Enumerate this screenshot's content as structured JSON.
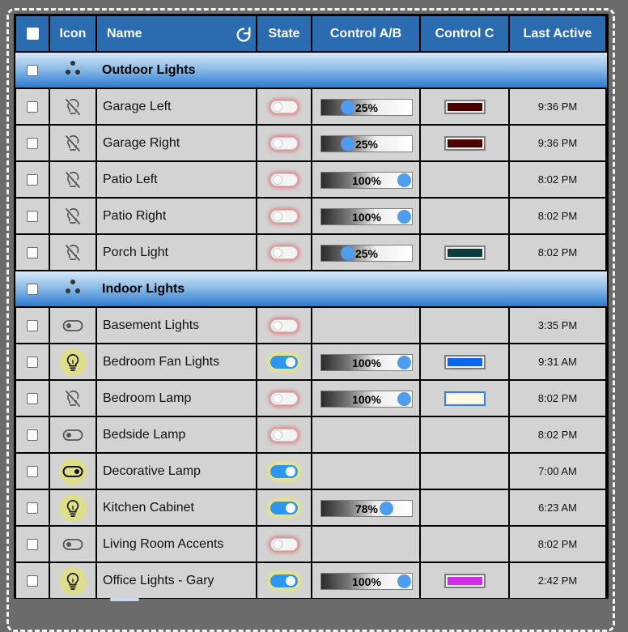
{
  "header": {
    "icon_label": "Icon",
    "name_label": "Name",
    "state_label": "State",
    "control_ab_label": "Control A/B",
    "control_c_label": "Control C",
    "last_active_label": "Last Active"
  },
  "groups": [
    {
      "title": "Outdoor Lights",
      "devices": [
        {
          "name": "Garage Left",
          "icon": "bulb-off-icon",
          "state": "off",
          "level": 25,
          "level_label": "25%",
          "color": "#4a0000",
          "last_active": "9:36 PM"
        },
        {
          "name": "Garage Right",
          "icon": "bulb-off-icon",
          "state": "off",
          "level": 25,
          "level_label": "25%",
          "color": "#4a0000",
          "last_active": "9:36 PM"
        },
        {
          "name": "Patio Left",
          "icon": "bulb-off-icon",
          "state": "off",
          "level": 100,
          "level_label": "100%",
          "color": null,
          "last_active": "8:02 PM"
        },
        {
          "name": "Patio Right",
          "icon": "bulb-off-icon",
          "state": "off",
          "level": 100,
          "level_label": "100%",
          "color": null,
          "last_active": "8:02 PM"
        },
        {
          "name": "Porch Light",
          "icon": "bulb-off-icon",
          "state": "off",
          "level": 25,
          "level_label": "25%",
          "color": "#0c3d3d",
          "last_active": "8:02 PM"
        }
      ]
    },
    {
      "title": "Indoor Lights",
      "devices": [
        {
          "name": "Basement Lights",
          "icon": "switch-off-icon",
          "state": "off",
          "level": null,
          "level_label": null,
          "color": null,
          "last_active": "3:35 PM"
        },
        {
          "name": "Bedroom Fan Lights",
          "icon": "bulb-on-icon",
          "state": "on",
          "level": 100,
          "level_label": "100%",
          "color": "#0a67f5",
          "last_active": "9:31 AM"
        },
        {
          "name": "Bedroom Lamp",
          "icon": "bulb-off-icon",
          "state": "off",
          "level": 100,
          "level_label": "100%",
          "color": "#fffbe0",
          "color_selected": true,
          "last_active": "8:02 PM"
        },
        {
          "name": "Bedside Lamp",
          "icon": "switch-off-icon",
          "state": "off",
          "level": null,
          "level_label": null,
          "color": null,
          "last_active": "8:02 PM"
        },
        {
          "name": "Decorative Lamp",
          "icon": "switch-on-icon",
          "state": "on",
          "level": null,
          "level_label": null,
          "color": null,
          "last_active": "7:00 AM"
        },
        {
          "name": "Kitchen Cabinet",
          "icon": "bulb-on-icon",
          "state": "on",
          "level": 78,
          "level_label": "78%",
          "color": null,
          "last_active": "6:23 AM"
        },
        {
          "name": "Living Room Accents",
          "icon": "switch-off-icon",
          "state": "off",
          "level": null,
          "level_label": null,
          "color": null,
          "last_active": "8:02 PM"
        },
        {
          "name": "Office Lights - Gary",
          "icon": "bulb-on-icon",
          "state": "on",
          "level": 100,
          "level_label": "100%",
          "color": "#d42af0",
          "last_active": "2:42 PM"
        }
      ]
    }
  ],
  "colors": {
    "header_bg": "#2b6cb0",
    "toggle_on": "#2d96ee",
    "slider_thumb": "#4f9df0"
  }
}
